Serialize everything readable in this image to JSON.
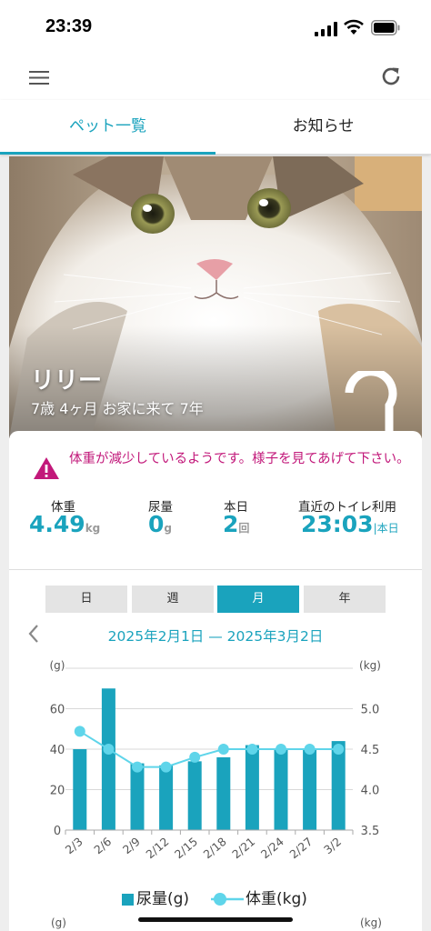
{
  "status_bar": {
    "time": "23:39"
  },
  "tabs": [
    {
      "label": "ペット一覧"
    },
    {
      "label": "お知らせ"
    }
  ],
  "pet": {
    "name": "リリー",
    "age_line": "7歳 4ヶ月 お家に来て 7年"
  },
  "alert": {
    "text": "体重が減少しているようです。様子を見てあげて下さい。"
  },
  "stats": [
    {
      "label": "体重",
      "value": "4.49",
      "unit": "kg"
    },
    {
      "label": "尿量",
      "value": "0",
      "unit": "g"
    },
    {
      "label": "本日",
      "value": "2",
      "unit": "回"
    },
    {
      "label": "直近のトイレ利用",
      "value": "23:03",
      "unit": "|本日"
    }
  ],
  "period_buttons": [
    {
      "label": "日",
      "active": false
    },
    {
      "label": "週",
      "active": false
    },
    {
      "label": "月",
      "active": true
    },
    {
      "label": "年",
      "active": false
    }
  ],
  "date_range": "2025年2月1日 — 2025年3月2日",
  "colors": {
    "accent": "#1aa3bd",
    "line": "#5fd5ea",
    "alert": "#c2187a"
  },
  "chart_data": {
    "type": "bar",
    "categories": [
      "2/3",
      "2/6",
      "2/9",
      "2/12",
      "2/15",
      "2/18",
      "2/21",
      "2/24",
      "2/27",
      "3/2"
    ],
    "series": [
      {
        "name": "尿量(g)",
        "type": "bar",
        "axis": "left",
        "values": [
          40,
          70,
          33,
          32,
          34,
          36,
          42,
          40,
          40,
          44
        ]
      },
      {
        "name": "体重(kg)",
        "type": "line",
        "axis": "right",
        "values": [
          4.72,
          4.5,
          4.28,
          4.28,
          4.4,
          4.5,
          4.5,
          4.5,
          4.5,
          4.5
        ]
      }
    ],
    "ylabel_left": "(g)",
    "ylabel_right": "(kg)",
    "ylim_left": [
      0,
      80
    ],
    "ylim_right": [
      3.5,
      5.5
    ],
    "yticks_left": [
      0,
      20,
      40,
      60
    ],
    "yticks_right": [
      3.5,
      4.0,
      4.5,
      5.0
    ],
    "grid": true,
    "legend_position": "bottom"
  },
  "legend": {
    "bar_label": "尿量(g)",
    "line_label": "体重(kg)"
  },
  "next_chart": {
    "left_unit": "(g)",
    "right_unit": "(kg)"
  }
}
